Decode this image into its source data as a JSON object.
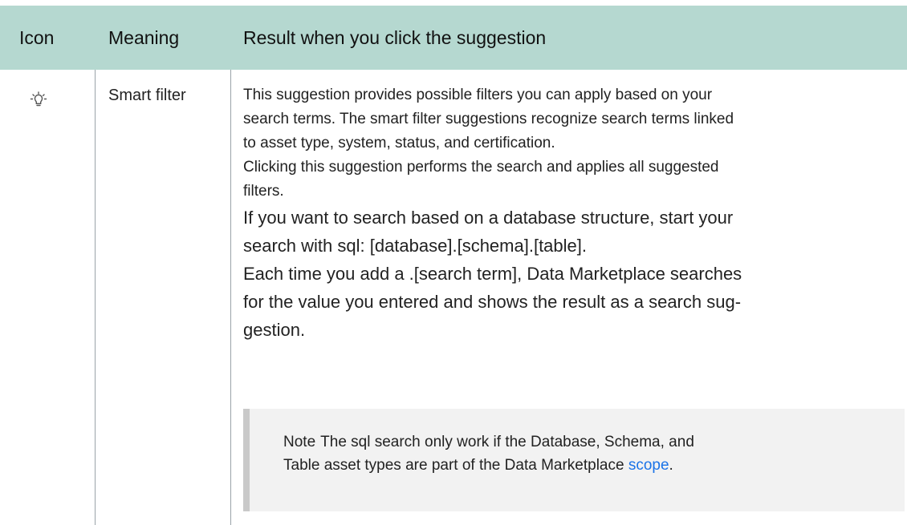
{
  "table": {
    "headers": {
      "icon": "Icon",
      "meaning": "Meaning",
      "result": "Result when you click the suggestion"
    },
    "row": {
      "icon_name": "lightbulb-icon",
      "meaning": "Smart filter",
      "paragraphs_small": [
        "This suggestion provides possible filters you can apply based on your",
        "search terms. The smart filter suggestions recognize search terms linked",
        "to asset type, system, status, and certification.",
        "Clicking this suggestion performs the search and applies all suggested",
        "filters."
      ],
      "paragraphs_large": [
        "If you want to search based on a database structure, start your",
        "search with sql: [database].[schema].[table].",
        "Each time you add a .[search term], Data Marketplace searches",
        "for the value you entered and shows the result as a search sug-",
        "gestion."
      ],
      "note": {
        "label": "Note",
        "line1": "The sql search only work if the Database, Schema, and",
        "line2_before_link": "Table asset types are part of the Data Marketplace ",
        "link_text": "scope",
        "line2_after_link": "."
      }
    }
  },
  "colors": {
    "header_background": "#b5d8d0",
    "note_background": "#f2f2f2",
    "note_bar": "#c9c9c9",
    "link": "#1a73e8"
  }
}
